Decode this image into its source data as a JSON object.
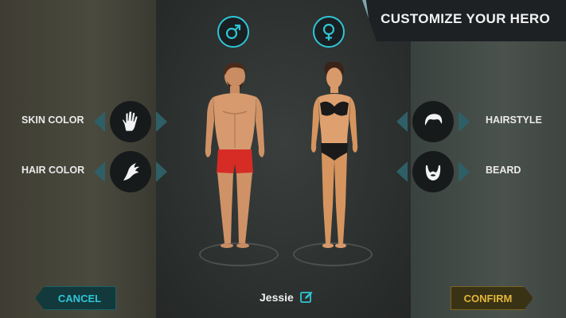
{
  "header": {
    "title": "CUSTOMIZE YOUR HERO"
  },
  "gender": {
    "male_icon": "male-symbol-icon",
    "female_icon": "female-symbol-icon",
    "selected": "male"
  },
  "left_options": [
    {
      "label": "SKIN COLOR",
      "icon": "hand-icon"
    },
    {
      "label": "HAIR COLOR",
      "icon": "hair-swoosh-icon"
    }
  ],
  "right_options": [
    {
      "label": "HAIRSTYLE",
      "icon": "hairstyle-icon"
    },
    {
      "label": "BEARD",
      "icon": "beard-icon"
    }
  ],
  "footer": {
    "cancel_label": "CANCEL",
    "confirm_label": "CONFIRM",
    "hero_name": "Jessie",
    "edit_icon": "edit-icon"
  },
  "colors": {
    "accent_cyan": "#2fc6d6",
    "confirm_gold": "#e2b63a",
    "arrow_teal": "#2f5f66"
  }
}
